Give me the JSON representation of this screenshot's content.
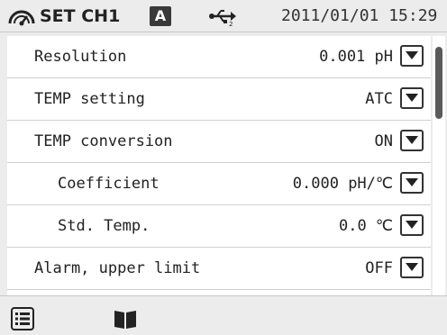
{
  "header": {
    "title": "SET CH1",
    "badge": "A",
    "datetime": "2011/01/01 15:29",
    "status_icon": "gauge-icon",
    "usb_icon": "usb-icon"
  },
  "settings": [
    {
      "label": "Resolution",
      "value": "0.001 pH"
    },
    {
      "label": "TEMP setting",
      "value": "ATC"
    },
    {
      "label": "TEMP conversion",
      "value": "ON"
    },
    {
      "label": "Coefficient",
      "value": "0.000 pH/℃"
    },
    {
      "label": "Std. Temp.",
      "value": "0.0 ℃"
    },
    {
      "label": "Alarm, upper limit",
      "value": "OFF"
    }
  ],
  "footer": {
    "menu_icon": "list-menu-icon",
    "manual_icon": "book-icon"
  },
  "colors": {
    "background": "#ececec",
    "list_bg": "#ffffff",
    "text": "#222222",
    "scroll_thumb": "#5a5a5a"
  }
}
